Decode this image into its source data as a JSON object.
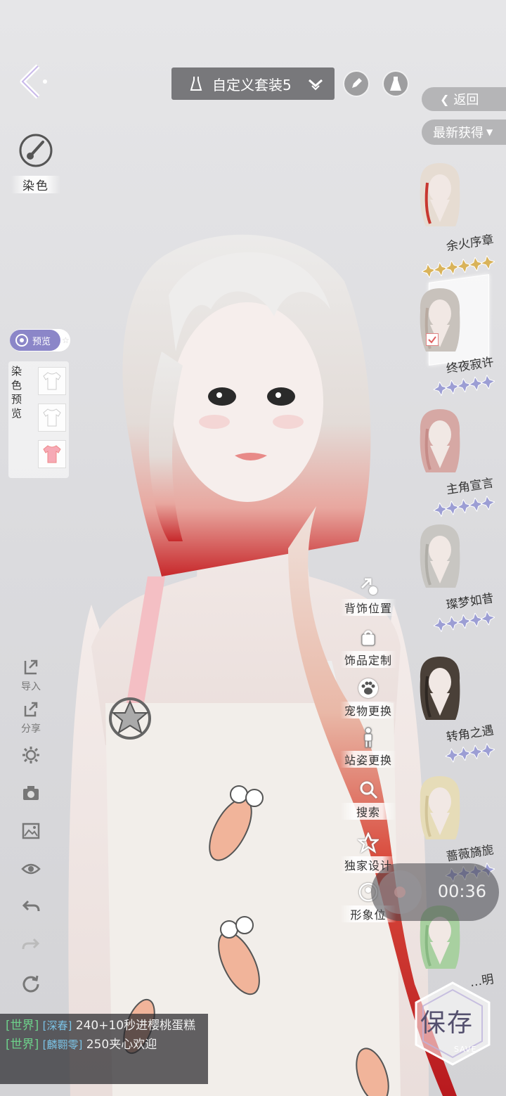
{
  "topbar": {
    "outfit_name": "自定义套装5",
    "return_label": "返回",
    "sort_label": "最新获得"
  },
  "dye": {
    "label": "染色",
    "preview_toggle": "预览",
    "preview_title": "染色预览"
  },
  "tools": [
    {
      "icon": "import-icon",
      "label": "导入"
    },
    {
      "icon": "share-icon",
      "label": "分享"
    },
    {
      "icon": "settings-gear-icon",
      "label": ""
    },
    {
      "icon": "camera-icon",
      "label": ""
    },
    {
      "icon": "image-icon",
      "label": ""
    },
    {
      "icon": "eye-icon",
      "label": ""
    },
    {
      "icon": "undo-icon",
      "label": ""
    },
    {
      "icon": "redo-icon",
      "label": ""
    },
    {
      "icon": "reset-icon",
      "label": ""
    }
  ],
  "actions": [
    {
      "icon": "back-accessory-icon",
      "label": "背饰位置"
    },
    {
      "icon": "bag-icon",
      "label": "饰品定制"
    },
    {
      "icon": "paw-icon",
      "label": "宠物更换"
    },
    {
      "icon": "person-icon",
      "label": "站姿更换"
    },
    {
      "icon": "search-icon",
      "label": "搜索"
    },
    {
      "icon": "star-icon",
      "label": "独家设计"
    },
    {
      "icon": "silhouette-icon",
      "label": "形象位"
    }
  ],
  "items": [
    {
      "name": "余火序章",
      "stars": 6,
      "star_color": "#d9b35a",
      "hair_color": "#e6dcd2",
      "accent": "#c8372f"
    },
    {
      "name": "终夜寂许",
      "stars": 5,
      "star_color": "#9c9ed4",
      "hair_color": "#c8c2bc",
      "accent": "#b8aaa0",
      "selected": true
    },
    {
      "name": "主角宣言",
      "stars": 5,
      "star_color": "#9c9ed4",
      "hair_color": "#d6a8a4",
      "accent": "#c68c88"
    },
    {
      "name": "璨梦如昔",
      "stars": 5,
      "star_color": "#9c9ed4",
      "hair_color": "#c8c6c2",
      "accent": "#b0aea8"
    },
    {
      "name": "转角之遇",
      "stars": 4,
      "star_color": "#9c9ed4",
      "hair_color": "#4a4038",
      "accent": "#2e2722"
    },
    {
      "name": "蔷薇旖旎",
      "stars": 4,
      "star_color": "#9c9ed4",
      "hair_color": "#e6dcb8",
      "accent": "#d2c498"
    },
    {
      "name": "…明",
      "stars": 0,
      "star_color": "#9c9ed4",
      "hair_color": "#a8d0a0",
      "accent": "#88b882"
    }
  ],
  "recording": {
    "time": "00:36"
  },
  "save": {
    "label": "保存",
    "sub": "SAVE"
  },
  "chat": [
    {
      "channel": "[世界]",
      "user": "[深春]",
      "text": "240+10秒进樱桃蛋糕"
    },
    {
      "channel": "[世界]",
      "user": "[麟翾零]",
      "text": "250夹心欢迎"
    }
  ]
}
